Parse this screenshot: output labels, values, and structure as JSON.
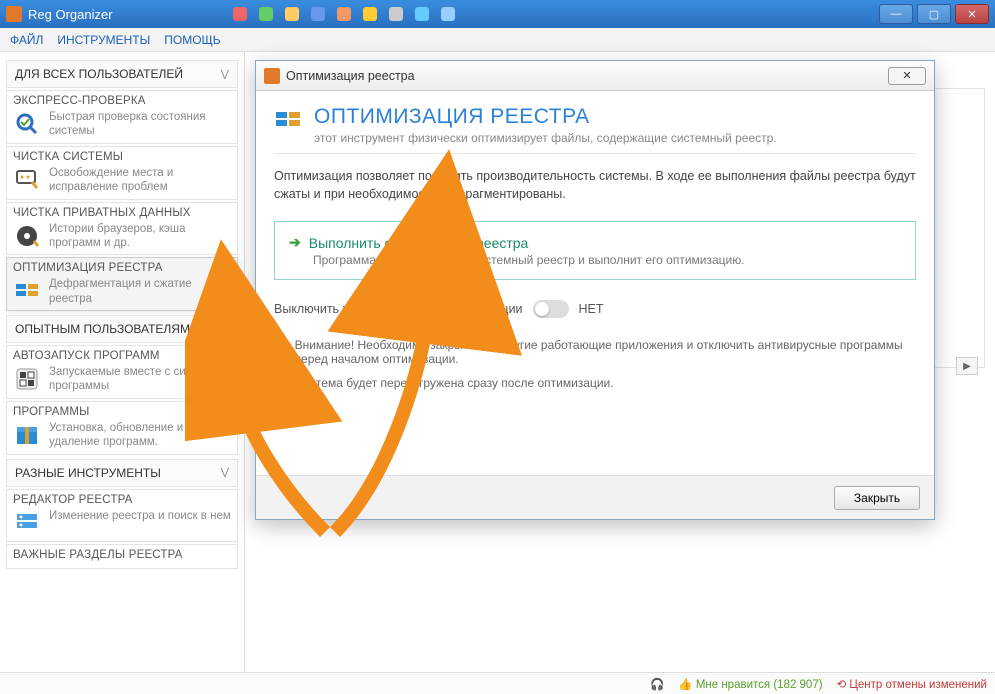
{
  "window": {
    "title": "Reg Organizer"
  },
  "menu": {
    "file": "ФАЙЛ",
    "tools": "ИНСТРУМЕНТЫ",
    "help": "ПОМОЩЬ"
  },
  "sidebar": {
    "sec1": "ДЛЯ ВСЕХ ПОЛЬЗОВАТЕЛЕЙ",
    "sec2": "ОПЫТНЫМ ПОЛЬЗОВАТЕЛЯМ",
    "sec3": "РАЗНЫЕ ИНСТРУМЕНТЫ",
    "items": [
      {
        "title": "ЭКСПРЕСС-ПРОВЕРКА",
        "desc": "Быстрая проверка состояния системы"
      },
      {
        "title": "ЧИСТКА СИСТЕМЫ",
        "desc": "Освобождение места и исправление проблем"
      },
      {
        "title": "ЧИСТКА ПРИВАТНЫХ ДАННЫХ",
        "desc": "Истории браузеров, кэша программ и др."
      },
      {
        "title": "ОПТИМИЗАЦИЯ РЕЕСТРА",
        "desc": "Дефрагментация и сжатие реестра"
      },
      {
        "title": "АВТОЗАПУСК ПРОГРАММ",
        "desc": "Запускаемые вместе с системой программы"
      },
      {
        "title": "ПРОГРАММЫ",
        "desc": "Установка, обновление и удаление программ."
      },
      {
        "title": "РЕДАКТОР РЕЕСТРА",
        "desc": "Изменение реестра и поиск в нем"
      },
      {
        "title": "ВАЖНЫЕ РАЗДЕЛЫ РЕЕСТРА",
        "desc": ""
      }
    ]
  },
  "dialog": {
    "title": "Оптимизация реестра",
    "heading": "ОПТИМИЗАЦИЯ РЕЕСТРА",
    "sub": "этот инструмент физически оптимизирует файлы, содержащие системный реестр.",
    "para": "Оптимизация позволяет повысить производительность системы. В ходе ее выполнения файлы реестра будут сжаты и при необходимости дефрагментированы.",
    "action_title": "Выполнить оптимизацию реестра",
    "action_desc": "Программа проанализирует системный реестр и выполнит его оптимизацию.",
    "toggle_label": "Выключить компьютер после оптимизации",
    "toggle_state": "НЕТ",
    "warn1": "Внимание! Необходимо закрыть все другие работающие приложения и отключить антивирусные программы перед началом оптимизации.",
    "warn2": "Система будет перезагружена сразу после оптимизации.",
    "close_btn": "Закрыть"
  },
  "status": {
    "like": "Мне нравится (182 907)",
    "cancel_center": "Центр отмены изменений"
  }
}
